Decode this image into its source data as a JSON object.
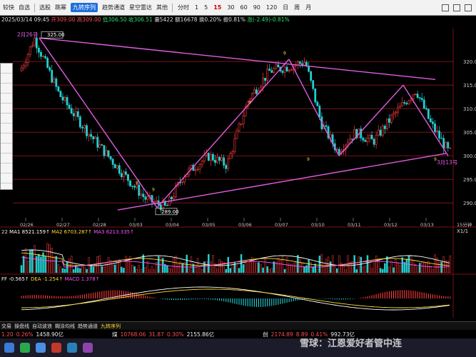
{
  "toolbar": {
    "items": [
      "较快",
      "自选",
      "选股",
      "跳幂",
      "九转序列",
      "趋势通道",
      "星空雷达",
      "其他"
    ],
    "periods": [
      "分时",
      "1",
      "5",
      "15",
      "30",
      "60",
      "90",
      "120",
      "日",
      "周",
      "月"
    ],
    "active_period": "15"
  },
  "infobar": {
    "date": "2025/03/14 09:45",
    "open": "开309.00",
    "high": "高309.00",
    "low": "低306.50",
    "close": "收306.51",
    "volume": "量5422",
    "amount": "额16678",
    "turnover": "换0.20%",
    "amplitude": "振0.81%",
    "change": "涨(-2.49)-0.81%"
  },
  "chart_data": {
    "type": "candlestick",
    "y_ticks": [
      290,
      295,
      300,
      305,
      310,
      315,
      320
    ],
    "x_ticks": [
      "02/26",
      "02/27",
      "02/28",
      "03/03",
      "03/04",
      "03/05",
      "03/06",
      "03/07",
      "03/10",
      "03/11",
      "03/12",
      "03/13",
      "15分钟"
    ],
    "high_mark": "325.00",
    "low_mark": "289.00",
    "annotations": [
      "2月26号",
      "3月13号"
    ],
    "nine_counts": [
      "9",
      "9",
      "9",
      "9",
      "9",
      "9"
    ],
    "ylim": [
      287,
      327
    ]
  },
  "volume_pane": {
    "label": "22",
    "ma1": "MA1 8521.159↑",
    "ma2": "MA2 6703.287↑",
    "ma3": "MA3 6213.335↑",
    "scale": "X1/1"
  },
  "macd_pane": {
    "label": "FF -0.565↑",
    "dea": "DEA -1.254↑",
    "macd": "MACD 1.378↑"
  },
  "status_tabs": [
    "交易",
    "操盘线",
    "自动波浪",
    "糊涂均线",
    "趋势通道",
    "九转序列"
  ],
  "bottom_left": {
    "price": "1.20",
    "pct": "0.26%",
    "vol": "1458.90亿"
  },
  "bottom_center": {
    "label": "煤",
    "a": "10768.06",
    "b": "31.87",
    "c": "0.30%",
    "d": "2155.86亿"
  },
  "bottom_right": {
    "label": "创",
    "a": "2174.89",
    "b": "8.89",
    "c": "0.41%",
    "d": "992.73亿"
  },
  "watermark": "雪球：江恩爱好者管中连",
  "colors": {
    "up": "#ff3b3b",
    "down": "#22d0d0",
    "trend": "#e05ce0",
    "grid_red": "#8a1a1a"
  }
}
